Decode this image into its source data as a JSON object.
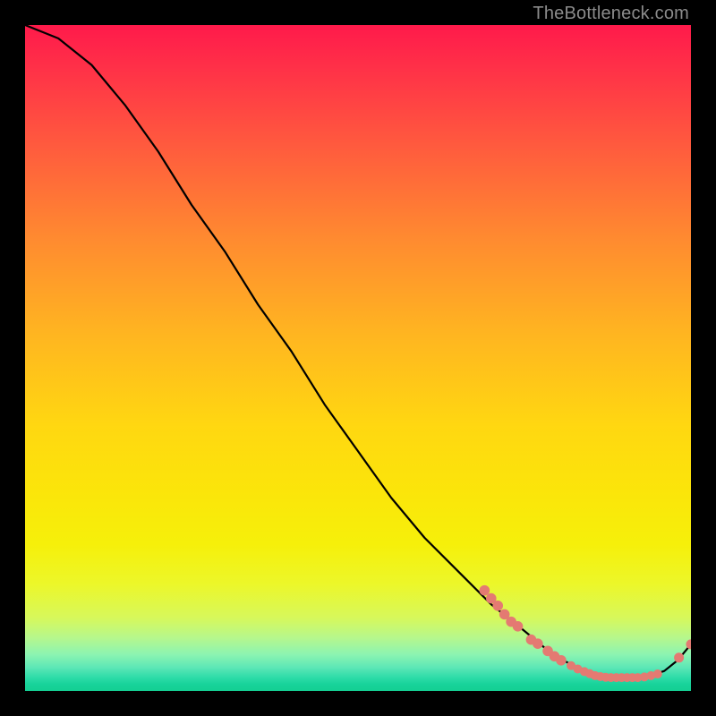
{
  "watermark": "TheBottleneck.com",
  "chart_data": {
    "type": "line",
    "title": "",
    "xlabel": "",
    "ylabel": "",
    "xlim": [
      0,
      100
    ],
    "ylim": [
      0,
      100
    ],
    "grid": false,
    "legend": false,
    "series": [
      {
        "name": "curve",
        "x": [
          0,
          5,
          10,
          15,
          20,
          25,
          30,
          35,
          40,
          45,
          50,
          55,
          60,
          65,
          70,
          75,
          78,
          80,
          83,
          86,
          88,
          90,
          92,
          94,
          96,
          98,
          100
        ],
        "y": [
          100,
          98,
          94,
          88,
          81,
          73,
          66,
          58,
          51,
          43,
          36,
          29,
          23,
          18,
          13,
          9,
          6.5,
          5,
          3.5,
          2.5,
          2,
          2,
          2,
          2.3,
          3,
          4.6,
          7
        ]
      }
    ],
    "markers": {
      "name": "highlighted-points",
      "color": "#e47a72",
      "points": [
        {
          "x": 69,
          "y": 15.1,
          "r": 5.3
        },
        {
          "x": 70,
          "y": 13.9,
          "r": 5.3
        },
        {
          "x": 71,
          "y": 12.8,
          "r": 5.3
        },
        {
          "x": 72,
          "y": 11.5,
          "r": 5.3
        },
        {
          "x": 73,
          "y": 10.4,
          "r": 5.3
        },
        {
          "x": 74,
          "y": 9.7,
          "r": 5.3
        },
        {
          "x": 76,
          "y": 7.7,
          "r": 5.3
        },
        {
          "x": 77,
          "y": 7.1,
          "r": 5.3
        },
        {
          "x": 78.5,
          "y": 6.0,
          "r": 5.3
        },
        {
          "x": 79.5,
          "y": 5.2,
          "r": 5.3
        },
        {
          "x": 80.5,
          "y": 4.6,
          "r": 5.3
        },
        {
          "x": 82,
          "y": 3.8,
          "r": 4.5
        },
        {
          "x": 83,
          "y": 3.3,
          "r": 4.5
        },
        {
          "x": 84,
          "y": 2.9,
          "r": 4.5
        },
        {
          "x": 84.8,
          "y": 2.6,
          "r": 4.5
        },
        {
          "x": 85.6,
          "y": 2.3,
          "r": 4.5
        },
        {
          "x": 86.4,
          "y": 2.15,
          "r": 4.5
        },
        {
          "x": 87.2,
          "y": 2.05,
          "r": 4.5
        },
        {
          "x": 88,
          "y": 2.0,
          "r": 4.5
        },
        {
          "x": 88.8,
          "y": 2.0,
          "r": 4.5
        },
        {
          "x": 89.6,
          "y": 2.0,
          "r": 4.5
        },
        {
          "x": 90.4,
          "y": 2.0,
          "r": 4.5
        },
        {
          "x": 91.2,
          "y": 2.0,
          "r": 4.5
        },
        {
          "x": 92,
          "y": 2.0,
          "r": 4.5
        },
        {
          "x": 93,
          "y": 2.1,
          "r": 4.5
        },
        {
          "x": 94,
          "y": 2.3,
          "r": 4.5
        },
        {
          "x": 95,
          "y": 2.55,
          "r": 4.5
        },
        {
          "x": 98.2,
          "y": 5.0,
          "r": 5.0
        },
        {
          "x": 100,
          "y": 7.0,
          "r": 5.0
        }
      ]
    }
  }
}
